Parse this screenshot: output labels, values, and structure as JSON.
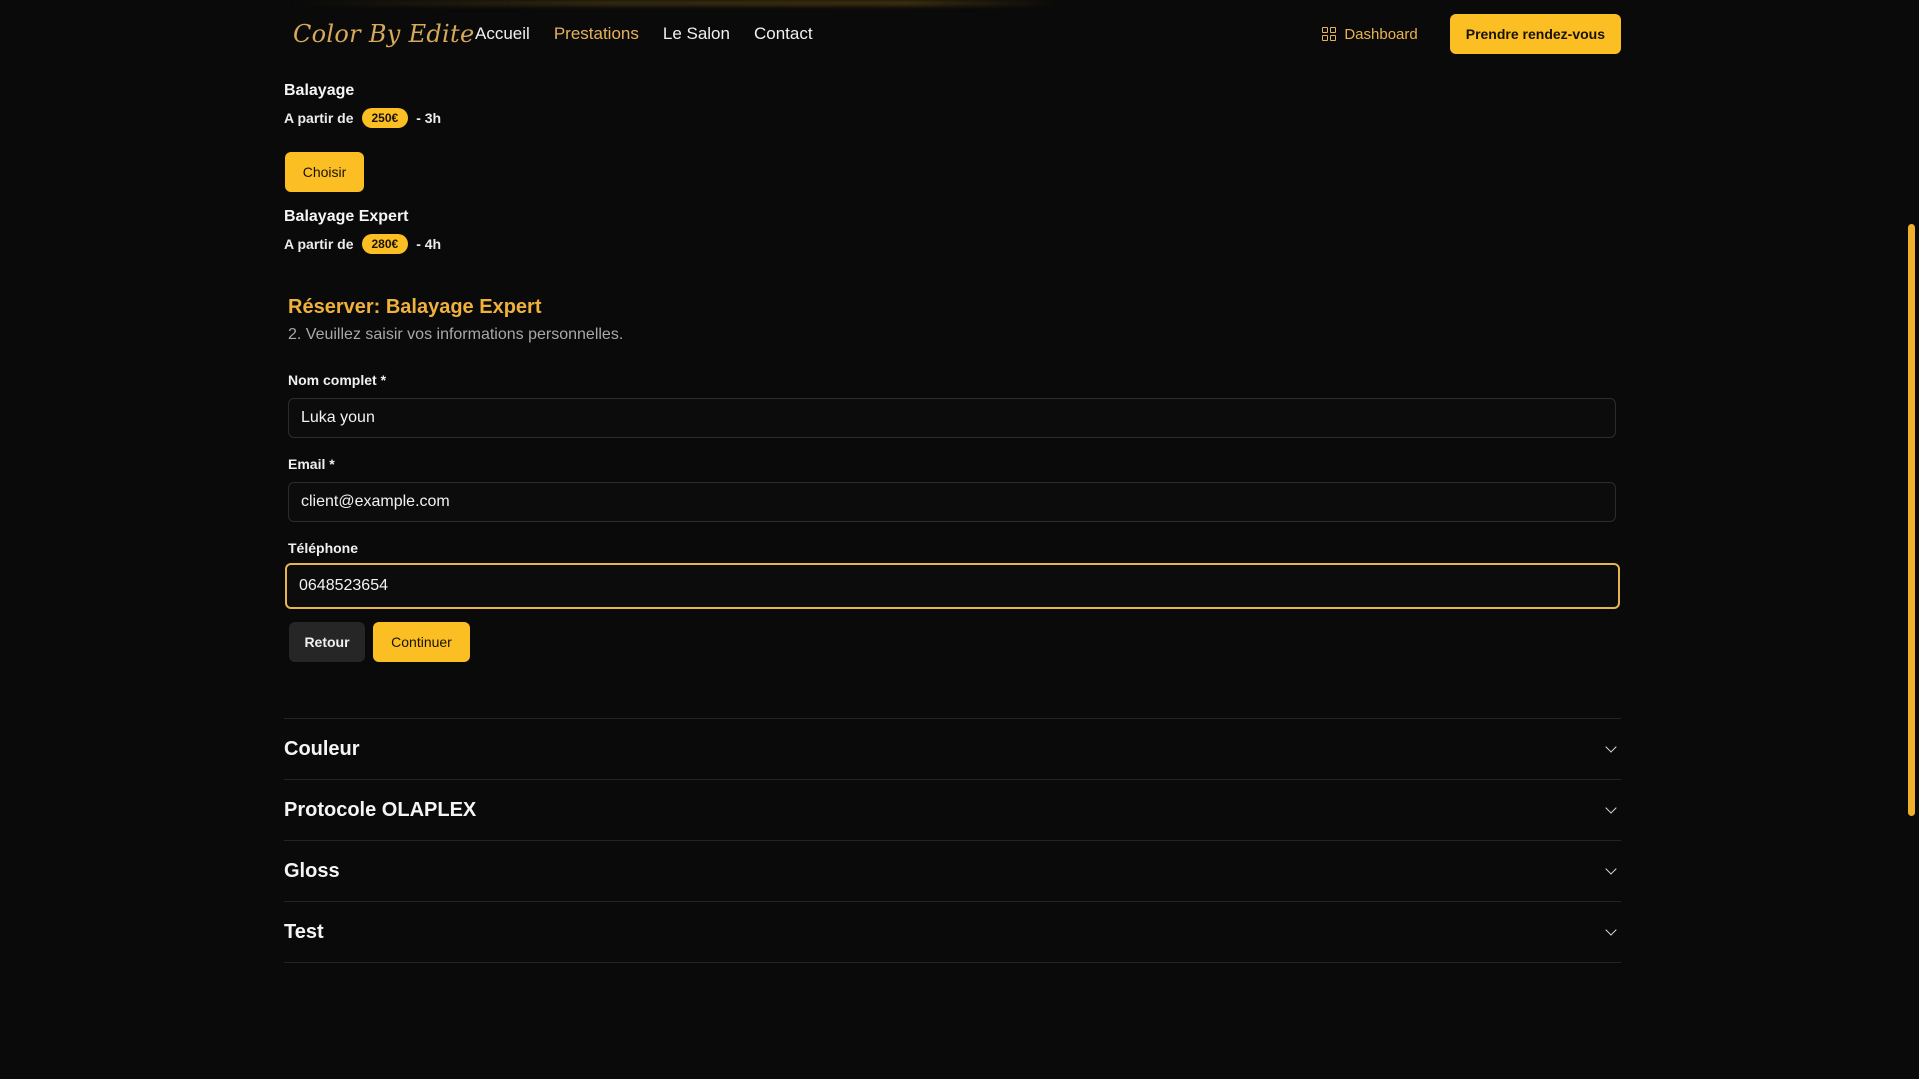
{
  "header": {
    "logo": "Color By Edite",
    "nav": [
      {
        "label": "Accueil",
        "active": false
      },
      {
        "label": "Prestations",
        "active": true
      },
      {
        "label": "Le Salon",
        "active": false
      },
      {
        "label": "Contact",
        "active": false
      }
    ],
    "dashboard_label": "Dashboard",
    "cta_label": "Prendre rendez-vous"
  },
  "services": [
    {
      "title": "Balayage",
      "prefix": "A partir de",
      "price": "250€",
      "duration": "- 3h",
      "choose_label": "Choisir"
    },
    {
      "title": "Balayage Expert",
      "prefix": "A partir de",
      "price": "280€",
      "duration": "- 4h"
    }
  ],
  "booking": {
    "title": "Réserver: Balayage Expert",
    "subtitle": "2. Veuillez saisir vos informations personnelles.",
    "fields": {
      "name": {
        "label": "Nom complet *",
        "value": "Luka youn"
      },
      "email": {
        "label": "Email *",
        "value": "client@example.com"
      },
      "phone": {
        "label": "Téléphone",
        "value": "0648523654"
      }
    },
    "back_label": "Retour",
    "continue_label": "Continuer"
  },
  "categories": [
    {
      "label": "Couleur"
    },
    {
      "label": "Protocole OLAPLEX"
    },
    {
      "label": "Gloss"
    },
    {
      "label": "Test"
    }
  ],
  "colors": {
    "accent": "#fbbf24",
    "accent_text": "#f0b13c",
    "background": "#0a0a0a"
  }
}
